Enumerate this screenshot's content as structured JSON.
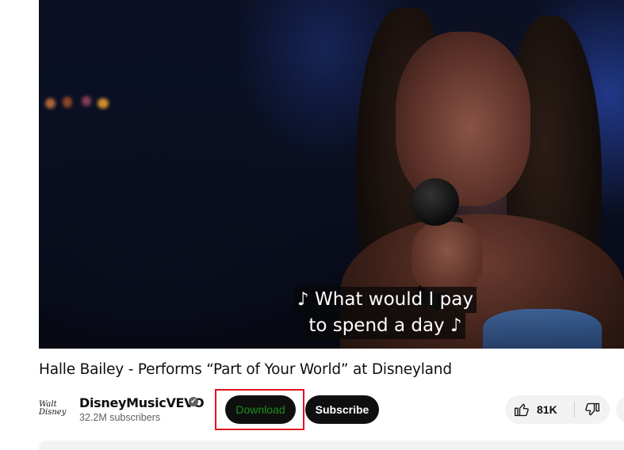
{
  "video": {
    "captions": [
      "♪ What would I pay",
      "to spend a day ♪"
    ]
  },
  "title": "Halle Bailey - Performs “Part of Your World” at Disneyland",
  "channel": {
    "logo_text": "Walt Disney",
    "name": "DisneyMusicVEVO",
    "verified_icon": "✔",
    "subscribers": "32.2M subscribers"
  },
  "actions": {
    "download_label": "Download",
    "subscribe_label": "Subscribe",
    "like_count": "81K"
  },
  "colors": {
    "download_text": "#1b8f1b",
    "highlight_border": "#e0141e"
  }
}
